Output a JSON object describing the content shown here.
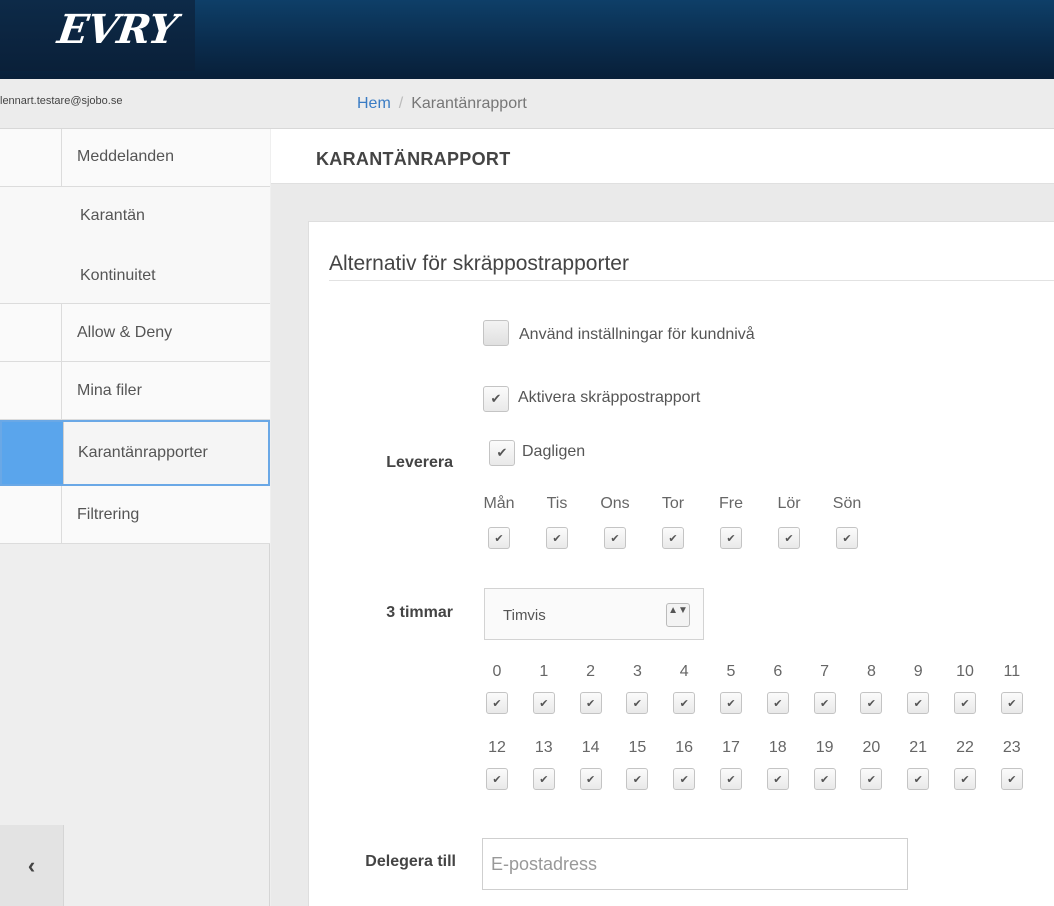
{
  "header": {
    "logo_text": "EVRY"
  },
  "user": {
    "email": "lennart.testare@sjobo.se"
  },
  "breadcrumb": {
    "home": "Hem",
    "separator": "/",
    "current": "Karantänrapport"
  },
  "sidebar": {
    "items": [
      {
        "label": "Meddelanden"
      },
      {
        "label": "Karantän"
      },
      {
        "label": "Kontinuitet"
      },
      {
        "label": "Allow & Deny"
      },
      {
        "label": "Mina filer"
      },
      {
        "label": "Karantänrapporter"
      },
      {
        "label": "Filtrering"
      }
    ],
    "collapse_icon": "‹"
  },
  "page": {
    "title": "KARANTÄNRAPPORT"
  },
  "panel": {
    "title": "Alternativ för skräppostrapporter",
    "use_customer_settings": {
      "label": "Använd inställningar för kundnivå",
      "checked": false
    },
    "enable_report": {
      "label": "Aktivera skräppostrapport",
      "checked": true
    },
    "deliver": {
      "label": "Leverera",
      "daily": {
        "label": "Dagligen",
        "checked": true
      },
      "days": [
        "Mån",
        "Tis",
        "Ons",
        "Tor",
        "Fre",
        "Lör",
        "Sön"
      ]
    },
    "interval": {
      "label": "3 timmar",
      "selected": "Timvis",
      "hours_row1": [
        "0",
        "1",
        "2",
        "3",
        "4",
        "5",
        "6",
        "7",
        "8",
        "9",
        "10",
        "11"
      ],
      "hours_row2": [
        "12",
        "13",
        "14",
        "15",
        "16",
        "17",
        "18",
        "19",
        "20",
        "21",
        "22",
        "23"
      ]
    },
    "delegate": {
      "label": "Delegera till",
      "placeholder": "E-postadress"
    }
  },
  "glyphs": {
    "check": "✔",
    "select_arrows": "▲▼"
  },
  "colors": {
    "header_dark": "#0a2c4d",
    "accent": "#5aa5ec",
    "link": "#3a7cc4"
  }
}
